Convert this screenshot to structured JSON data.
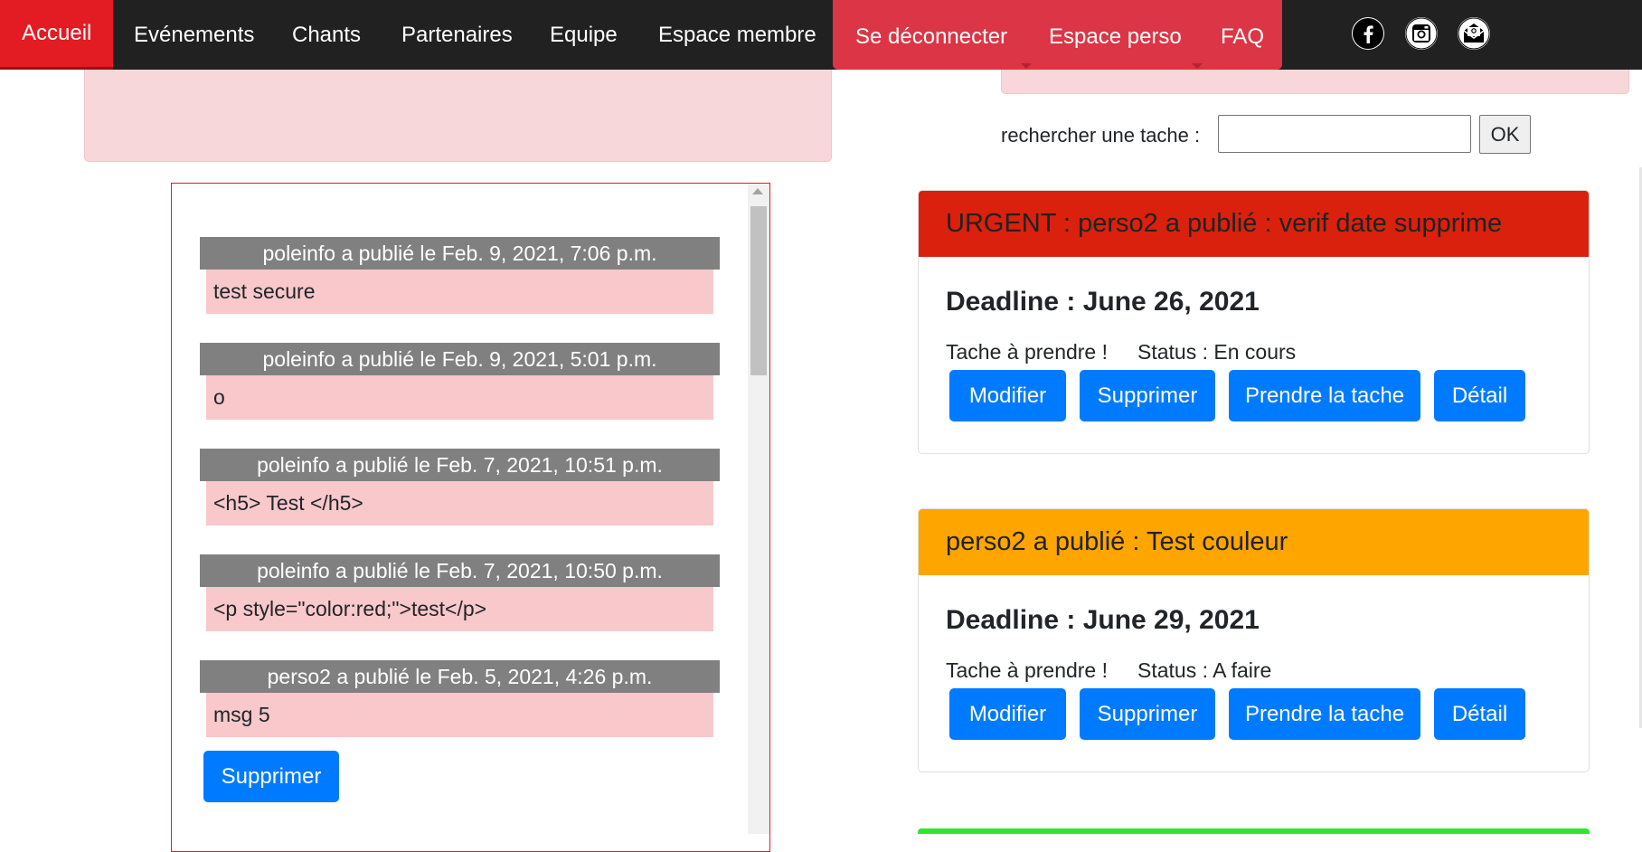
{
  "nav": {
    "items": [
      "Accueil",
      "Evénements",
      "Chants",
      "Partenaires",
      "Equipe",
      "Espace membre"
    ],
    "account_items": [
      "Se déconnecter",
      "Espace perso",
      "FAQ"
    ],
    "social_icons": [
      "facebook-icon",
      "instagram-icon",
      "mail-icon"
    ],
    "active_color": "#e31b23",
    "account_color": "#dc3545"
  },
  "search": {
    "label": "rechercher une tache :",
    "value": "",
    "button": "OK"
  },
  "messages": [
    {
      "header": "poleinfo a publié le Feb. 9, 2021, 7:06 p.m.",
      "body": "test secure"
    },
    {
      "header": "poleinfo a publié le Feb. 9, 2021, 5:01 p.m.",
      "body": "o"
    },
    {
      "header": "poleinfo a publié le Feb. 7, 2021, 10:51 p.m.",
      "body": "<h5> Test </h5>"
    },
    {
      "header": "poleinfo a publié le Feb. 7, 2021, 10:50 p.m.",
      "body": "<p style=\"color:red;\">test</p>"
    },
    {
      "header": "perso2 a publié le Feb. 5, 2021, 4:26 p.m.",
      "body": "msg 5"
    }
  ],
  "delete_button": "Supprimer",
  "tasks": [
    {
      "title": "URGENT : perso2 a publié : verif date supprime",
      "header_color": "#d9210d",
      "deadline": "Deadline : June 26, 2021",
      "take": "Tache à prendre !",
      "status": "Status : En cours",
      "buttons": [
        "Modifier",
        "Supprimer",
        "Prendre la tache",
        "Détail"
      ]
    },
    {
      "title": "perso2 a publié : Test couleur",
      "header_color": "#ffa500",
      "deadline": "Deadline : June 29, 2021",
      "take": "Tache à prendre !",
      "status": "Status : A faire",
      "buttons": [
        "Modifier",
        "Supprimer",
        "Prendre la tache",
        "Détail"
      ]
    }
  ],
  "colors": {
    "primary_button": "#007bff",
    "message_header": "#808080",
    "message_body": "#f8c8cb",
    "pink_panel": "#f8d7da",
    "third_task_color": "#2ee62e"
  }
}
